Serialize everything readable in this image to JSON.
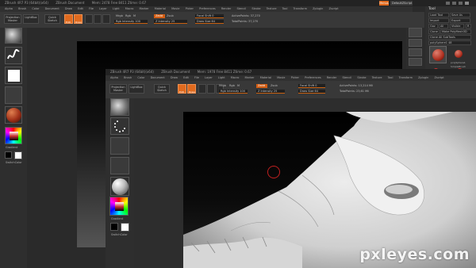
{
  "back_window": {
    "title_parts": [
      "ZBrush 4R7 P3 (64bit)(x64)",
      "ZBrush Document",
      "Mem: 2478 Free 8411 Ztime: 0.67"
    ],
    "status_pill": "Menus",
    "dropdown_label": "DefaultZScript",
    "menus": [
      "Alpha",
      "Brush",
      "Color",
      "Document",
      "Draw",
      "Edit",
      "File",
      "Layer",
      "Light",
      "Macro",
      "Marker",
      "Material",
      "Movie",
      "Picker",
      "Preferences",
      "Render",
      "Stencil",
      "Stroke",
      "Texture",
      "Tool",
      "Transform",
      "Zplugin",
      "Zscript"
    ],
    "toolbar": {
      "projection_master": "Projection Master",
      "lightbox": "LightBox",
      "quick_sketch": "Quick Sketch",
      "edit": "Edit",
      "draw": "Draw",
      "mrgb": "Mrgb",
      "rgb": "Rgb",
      "m": "M",
      "zadd": "Zadd",
      "zsub": "Zsub",
      "focal_shift": "Focal Shift 0",
      "draw_size": "Draw Size 64",
      "z_intensity": "Z Intensity 25",
      "rgb_intensity": "Rgb Intensity 100",
      "active_points": "ActivePoints: 37,270",
      "total_points": "TotalPoints: 37,270"
    },
    "right_panel": {
      "title": "Tool",
      "buttons": [
        "Load Tool",
        "Save As",
        "Import",
        "Export",
        "Goz",
        "All",
        "Visible",
        "R",
        "Clone",
        "Make PolyMesh3D",
        "Clone All SubTools",
        "polySphere1 48"
      ],
      "thumb_labels": [
        "polySphere1",
        "SimpleBrush"
      ]
    },
    "left_shelf": {
      "gradient_label": "Gradient",
      "switch_label": "SwitchColor"
    }
  },
  "front_window": {
    "title_parts": [
      "ZBrush 4R7 P3 (64bit)(x64)",
      "ZBrush Document",
      "Mem: 1978 Free 8411 Ztime: 0.67"
    ],
    "menus": [
      "Alpha",
      "Brush",
      "Color",
      "Document",
      "Draw",
      "Edit",
      "File",
      "Layer",
      "Light",
      "Macro",
      "Marker",
      "Material",
      "Movie",
      "Picker",
      "Preferences",
      "Render",
      "Stencil",
      "Stroke",
      "Texture",
      "Tool",
      "Transform",
      "Zplugin",
      "Zscript"
    ],
    "toolbar": {
      "projection_master": "Projection Master",
      "lightbox": "LightBox",
      "quick_sketch": "Quick Sketch",
      "edit": "Edit",
      "draw": "Draw",
      "mrgb": "Mrgb",
      "rgb": "Rgb",
      "m": "M",
      "zadd": "Zadd",
      "zsub": "Zsub",
      "focal_shift": "Focal Shift 0",
      "draw_size": "Draw Size 64",
      "z_intensity": "Z Intensity 25",
      "rgb_intensity": "Rgb Intensity 100",
      "active_points": "ActivePoints: 13,214 Mil",
      "total_points": "TotalPoints: 23,61 Mil"
    },
    "left_shelf": {
      "gradient_label": "Gradient",
      "switch_label": "SwitchColor"
    }
  },
  "watermark": "pxleyes.com",
  "colors": {
    "accent": "#e06a1e",
    "bg": "#2a2a2a",
    "cursor": "#c02020"
  }
}
